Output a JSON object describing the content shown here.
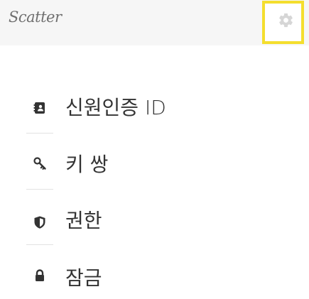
{
  "app": {
    "title": "Scatter"
  },
  "header": {
    "settings_icon": "gear-icon",
    "settings_highlight_color": "#f4de2e"
  },
  "menu": {
    "items": [
      {
        "label": "신원인증 ID",
        "icon": "address-book-icon"
      },
      {
        "label": "키 쌍",
        "icon": "key-icon"
      },
      {
        "label": "권한",
        "icon": "shield-icon"
      },
      {
        "label": "잠금",
        "icon": "lock-icon"
      }
    ]
  },
  "colors": {
    "topbar_bg": "#f6f6f6",
    "icon_color": "#333333",
    "text_color": "#333333"
  }
}
